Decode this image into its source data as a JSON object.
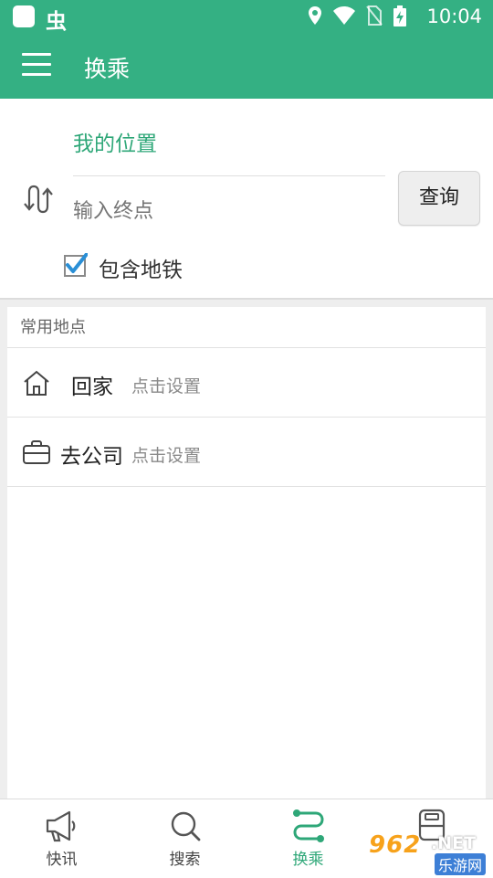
{
  "status_bar": {
    "bug_glyph": "虫",
    "time": "10:04"
  },
  "app_bar": {
    "title": "换乘"
  },
  "route": {
    "start_value": "我的位置",
    "end_placeholder": "输入终点",
    "query_label": "查询",
    "subway_label": "包含地铁",
    "subway_checked": true
  },
  "places": {
    "header": "常用地点",
    "items": [
      {
        "name": "回家",
        "hint": "点击设置",
        "icon": "home-icon"
      },
      {
        "name": "去公司",
        "hint": "点击设置",
        "icon": "briefcase-icon"
      }
    ]
  },
  "bottom_nav": {
    "items": [
      {
        "label": "快讯",
        "icon": "megaphone-icon",
        "active": false
      },
      {
        "label": "搜索",
        "icon": "search-icon",
        "active": false
      },
      {
        "label": "换乘",
        "icon": "route-icon",
        "active": true
      },
      {
        "label": "",
        "icon": "bus-icon",
        "active": false
      }
    ]
  },
  "watermark": {
    "number": "962",
    "domain": ".NET",
    "site_name": "乐游网"
  },
  "colors": {
    "accent": "#34b083",
    "accent_text": "#2ea778",
    "checkbox": "#2a8fd6"
  }
}
